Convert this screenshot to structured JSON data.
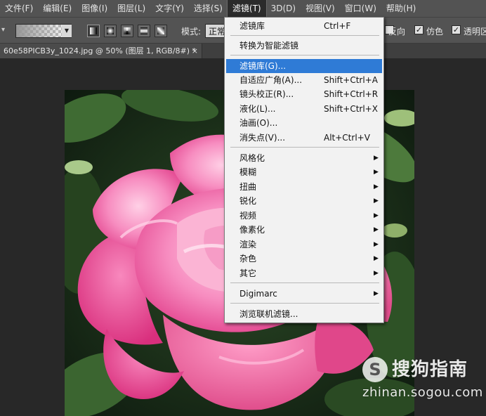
{
  "menubar": {
    "items": [
      "文件(F)",
      "编辑(E)",
      "图像(I)",
      "图层(L)",
      "文字(Y)",
      "选择(S)",
      "滤镜(T)",
      "3D(D)",
      "视图(V)",
      "窗口(W)",
      "帮助(H)"
    ],
    "active_index": 6
  },
  "options": {
    "mode_label": "模式:",
    "mode_value": "正常",
    "reverse_label": "反向",
    "dither_label": "仿色",
    "transparency_label": "透明区"
  },
  "document": {
    "tab_title": "60e58PICB3y_1024.jpg @ 50% (图层 1, RGB/8#) *",
    "close_glyph": "×"
  },
  "filter_menu": {
    "items": [
      {
        "label": "滤镜库",
        "shortcut": "Ctrl+F"
      },
      {
        "label": "转换为智能滤镜"
      },
      {
        "label": "滤镜库(G)...",
        "highlighted": true
      },
      {
        "label": "自适应广角(A)...",
        "shortcut": "Shift+Ctrl+A"
      },
      {
        "label": "镜头校正(R)...",
        "shortcut": "Shift+Ctrl+R"
      },
      {
        "label": "液化(L)...",
        "shortcut": "Shift+Ctrl+X"
      },
      {
        "label": "油画(O)..."
      },
      {
        "label": "消失点(V)...",
        "shortcut": "Alt+Ctrl+V"
      },
      {
        "label": "风格化",
        "submenu": true
      },
      {
        "label": "模糊",
        "submenu": true
      },
      {
        "label": "扭曲",
        "submenu": true
      },
      {
        "label": "锐化",
        "submenu": true
      },
      {
        "label": "视频",
        "submenu": true
      },
      {
        "label": "像素化",
        "submenu": true
      },
      {
        "label": "渲染",
        "submenu": true
      },
      {
        "label": "杂色",
        "submenu": true
      },
      {
        "label": "其它",
        "submenu": true
      },
      {
        "label": "Digimarc",
        "submenu": true
      },
      {
        "label": "浏览联机滤镜..."
      }
    ],
    "submenu_glyph": "▶"
  },
  "watermark": {
    "logo_glyph": "S",
    "text": "搜狗指南",
    "url": "zhinan.sogou.com"
  },
  "colors": {
    "menu_highlight": "#2f7bd6",
    "chrome": "#535353",
    "workspace": "#282828",
    "rose_pink": "#f05aa0"
  }
}
